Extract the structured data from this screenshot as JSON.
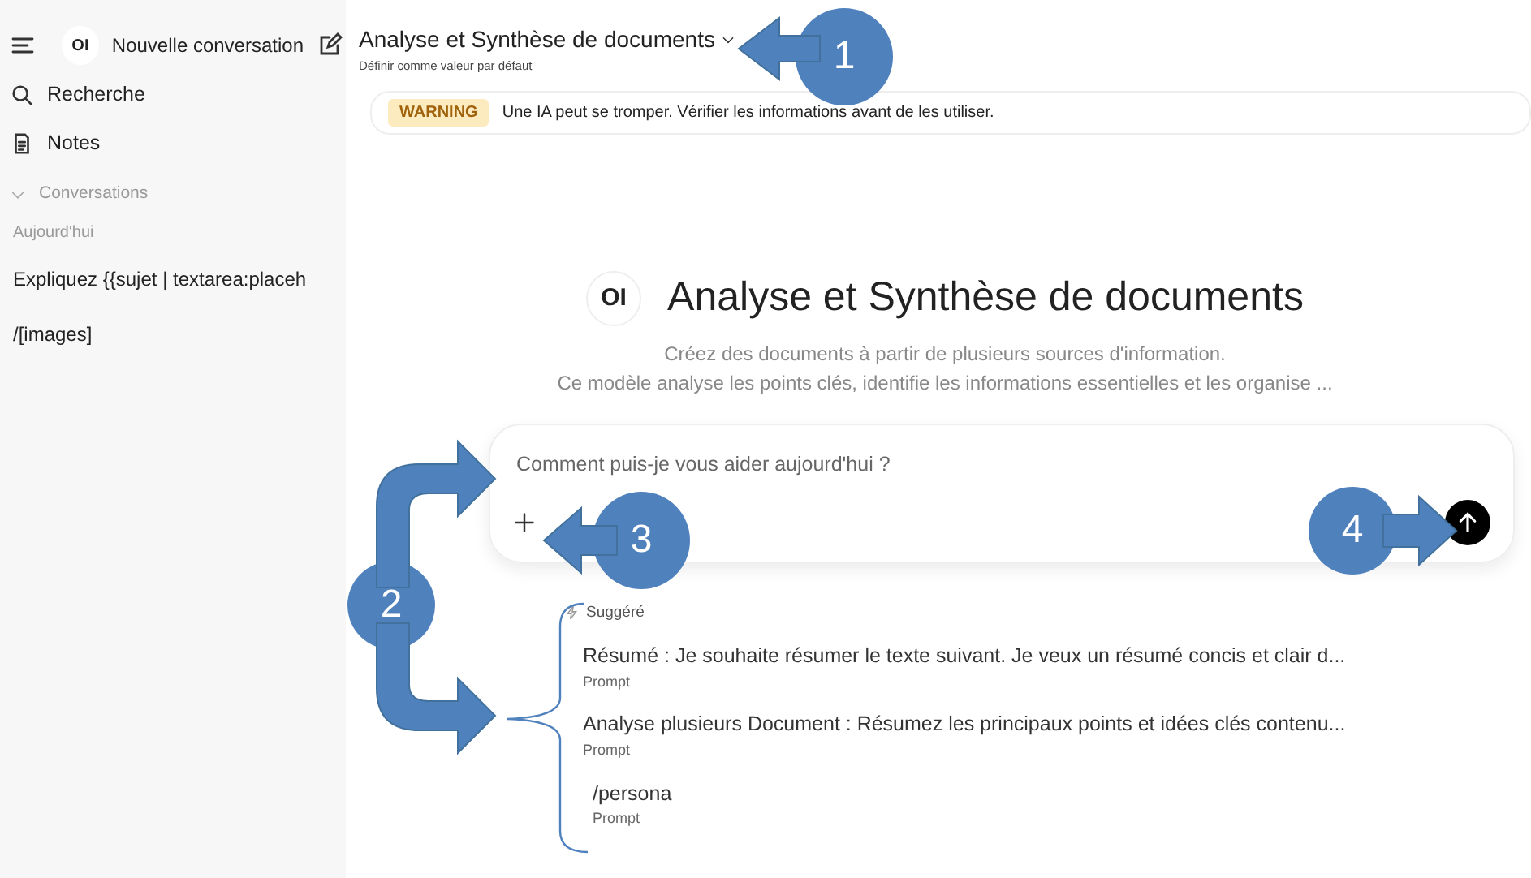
{
  "sidebar": {
    "logo": "OI",
    "app_name": "Nouvelle conversation",
    "nav": [
      {
        "label": "Recherche",
        "kind": "search"
      },
      {
        "label": "Notes",
        "kind": "notes"
      }
    ],
    "section": {
      "label": "Conversations",
      "expanded": true
    },
    "groups": [
      {
        "label": "Aujourd'hui",
        "chats": [
          "Expliquez {{sujet | textarea:placeh",
          "/[images]"
        ]
      }
    ]
  },
  "header": {
    "model": "Analyse et Synthèse de documents",
    "set_default": "Définir comme valeur par défaut"
  },
  "banner": {
    "badge": "WARNING",
    "text": "Une IA peut se tromper. Vérifier les informations avant de les utiliser."
  },
  "hero": {
    "logo": "OI",
    "title": "Analyse et Synthèse de documents",
    "lines": [
      "Créez des documents à partir de plusieurs sources d'information.",
      "Ce modèle analyse les points clés, identifie les informations essentielles et les organise ..."
    ]
  },
  "composer": {
    "placeholder": "Comment puis-je vous aider aujourd'hui ?"
  },
  "suggestions": {
    "label": "Suggéré",
    "items": [
      {
        "title": "Résumé : Je souhaite résumer le texte suivant. Je veux un résumé concis et clair d...",
        "type": "Prompt"
      },
      {
        "title": "Analyse plusieurs Document : Résumez les principaux points et idées clés contenu...",
        "type": "Prompt"
      },
      {
        "title": "/persona",
        "type": "Prompt"
      }
    ]
  },
  "callouts": [
    {
      "number": "1"
    },
    {
      "number": "2"
    },
    {
      "number": "3"
    },
    {
      "number": "4"
    }
  ]
}
